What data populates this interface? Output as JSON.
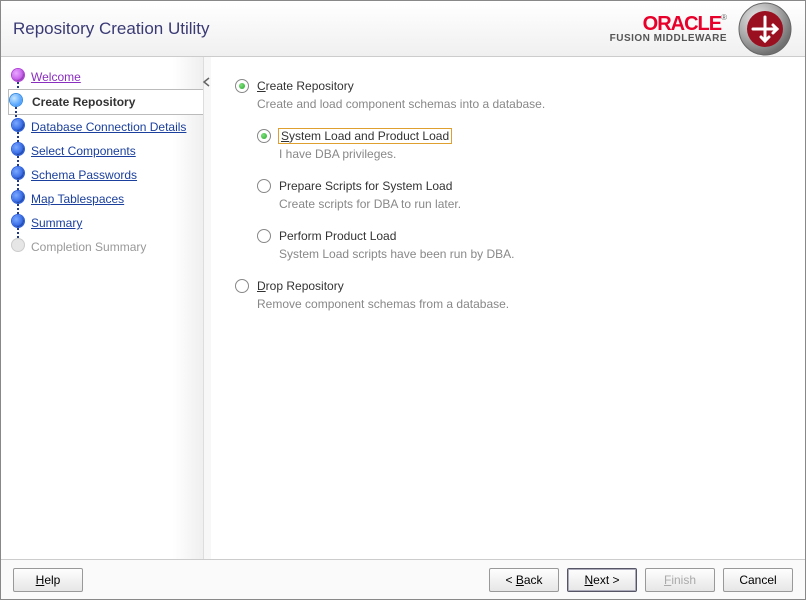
{
  "header": {
    "title": "Repository Creation Utility",
    "brand": "ORACLE",
    "brand_sub": "FUSION MIDDLEWARE"
  },
  "sidebar": {
    "steps": [
      {
        "label": "Welcome",
        "state": "visited"
      },
      {
        "label": "Create Repository",
        "state": "current"
      },
      {
        "label": "Database Connection Details",
        "state": "pending"
      },
      {
        "label": "Select Components",
        "state": "pending"
      },
      {
        "label": "Schema Passwords",
        "state": "pending"
      },
      {
        "label": "Map Tablespaces",
        "state": "pending"
      },
      {
        "label": "Summary",
        "state": "pending"
      },
      {
        "label": "Completion Summary",
        "state": "disabled"
      }
    ]
  },
  "main": {
    "create": {
      "label": "Create Repository",
      "desc": "Create and load component schemas into a database.",
      "selected": true
    },
    "create_subs": [
      {
        "label": "System Load and Product Load",
        "desc": "I have DBA privileges.",
        "selected": true,
        "focused": true
      },
      {
        "label": "Prepare Scripts for System Load",
        "desc": "Create scripts for DBA to run later.",
        "selected": false
      },
      {
        "label": "Perform Product Load",
        "desc": "System Load scripts have been run by DBA.",
        "selected": false
      }
    ],
    "drop": {
      "label": "Drop Repository",
      "desc": "Remove component schemas from a database.",
      "selected": false
    }
  },
  "footer": {
    "help": "Help",
    "back": "< Back",
    "next": "Next >",
    "finish": "Finish",
    "cancel": "Cancel"
  }
}
